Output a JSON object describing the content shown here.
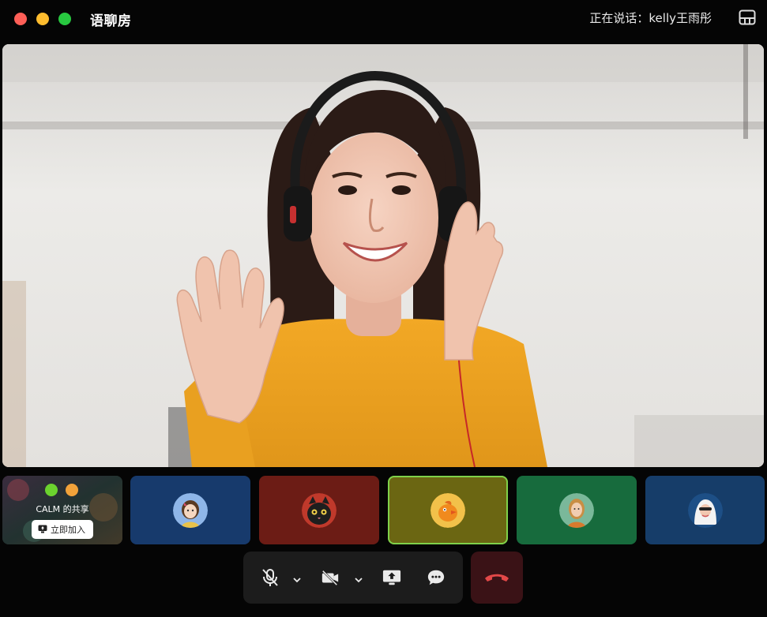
{
  "window": {
    "title": "语聊房",
    "speaking_label": "正在说话：kelly王雨彤",
    "traffic_colors": [
      "#fe5f57",
      "#febc2e",
      "#28c840"
    ]
  },
  "main_video": {
    "participant": "kelly王雨彤"
  },
  "share_tile": {
    "title": "CALM 的共享",
    "join_label": "立即加入"
  },
  "participants": [
    {
      "icon": "avatar-girl-icon",
      "color": "#173a6c"
    },
    {
      "icon": "avatar-black-cat-icon",
      "color": "#6c1c15"
    },
    {
      "icon": "avatar-orange-bird-icon",
      "color": "#6b6612",
      "border": "#7fd14a"
    },
    {
      "icon": "avatar-woman-icon",
      "color": "#176b3d"
    },
    {
      "icon": "avatar-white-hair-icon",
      "color": "#163d69"
    }
  ],
  "controls": {
    "mic": "mic-muted-icon",
    "camera": "camera-off-icon",
    "share": "screen-share-icon",
    "chat": "chat-icon",
    "hangup": "hang-up-icon",
    "hangup_color": "#e24848"
  }
}
